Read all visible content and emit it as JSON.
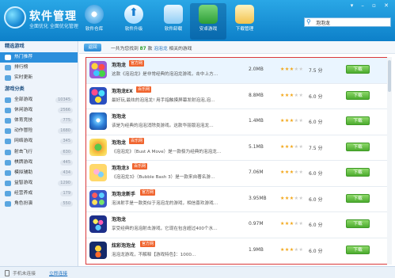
{
  "app": {
    "title": "软件管理",
    "subtitle": "全面优化 全面优化管理"
  },
  "window_controls": "▾ – ▫ ✕",
  "nav": [
    {
      "label": "软件仓库",
      "icon": "store-icon"
    },
    {
      "label": "软件升级",
      "icon": "upgrade-icon"
    },
    {
      "label": "软件卸载",
      "icon": "uninstall-icon"
    },
    {
      "label": "安卓游戏",
      "icon": "android-games-icon"
    },
    {
      "label": "下载管理",
      "icon": "download-manager-icon"
    }
  ],
  "search": {
    "value": "泡泡龙",
    "icon": "search-icon"
  },
  "sidebar": {
    "section1": "精选游戏",
    "featured": [
      {
        "label": "热门推荐",
        "active": true
      },
      {
        "label": "排行榜"
      },
      {
        "label": "实时更新"
      }
    ],
    "section2": "游戏分类",
    "categories": [
      {
        "label": "全部游戏",
        "count": "10345"
      },
      {
        "label": "休闲游戏",
        "count": "2566"
      },
      {
        "label": "体育竞技",
        "count": "775"
      },
      {
        "label": "动作冒险",
        "count": "1680"
      },
      {
        "label": "网络游戏",
        "count": "345"
      },
      {
        "label": "射击飞行",
        "count": "630"
      },
      {
        "label": "棋牌游戏",
        "count": "445"
      },
      {
        "label": "模拟辅助",
        "count": "434"
      },
      {
        "label": "益智游戏",
        "count": "1290"
      },
      {
        "label": "经营养成",
        "count": "179"
      },
      {
        "label": "角色扮演",
        "count": "550"
      }
    ]
  },
  "toolbar": {
    "back_label": "返回",
    "summary_prefix": "一共为您找到",
    "summary_count": "87",
    "summary_mid": "款",
    "summary_keyword": "泡泡龙",
    "summary_suffix": "相关的游戏"
  },
  "apps": [
    {
      "name": "泡泡龙",
      "tag": "官方网",
      "desc": "这款《泡泡龙》是非常经典的泡泡龙游戏，击中上方…",
      "size": "2.0MB",
      "stars": 3,
      "rating": "7.5 分",
      "download": "下载"
    },
    {
      "name": "泡泡龙EX",
      "tag": "百乐网",
      "desc": "最好玩,最炫的泡泡龙! 用手指触摸屏幕发射泡泡,泡…",
      "size": "8.8MB",
      "stars": 3,
      "rating": "6.0 分",
      "download": "下载"
    },
    {
      "name": "泡泡龙",
      "tag": "",
      "desc": "该是为经典的泡泡消除类游戏。这款华丽版泡泡龙…",
      "size": "1.4MB",
      "stars": 3,
      "rating": "6.0 分",
      "download": "下载"
    },
    {
      "name": "泡泡龙",
      "tag": "百乐网",
      "desc": "《泡泡龙》（Bust A Move）是一款极为经典的泡泡龙…",
      "size": "5.1MB",
      "stars": 3,
      "rating": "7.5 分",
      "download": "下载"
    },
    {
      "name": "泡泡龙3",
      "tag": "百乐网",
      "desc": "《泡泡龙3》（Bubble Bash 3）是一款来自著名游…",
      "size": "7.06M",
      "stars": 3,
      "rating": "6.0 分",
      "download": "下载"
    },
    {
      "name": "泡泡龙新手",
      "tag": "官方网",
      "desc": "泡沫射手是一款类似于泡泡龙的游戏，相信喜欢游戏…",
      "size": "3.95MB",
      "stars": 3,
      "rating": "6.0 分",
      "download": "下载"
    },
    {
      "name": "泡泡龙",
      "tag": "",
      "desc": "享受经典的泡泡射击游戏，它现在包含超过400个水…",
      "size": "0.97M",
      "stars": 3,
      "rating": "6.0 分",
      "download": "下载"
    },
    {
      "name": "炫彩泡泡龙",
      "tag": "官方网",
      "desc": "泡泡龙游戏，不解释【游戏特色】：1000…",
      "size": "1.9MB",
      "stars": 3,
      "rating": "6.0 分",
      "download": "下载"
    }
  ],
  "status": {
    "text": "手机未连接",
    "link": "立即连接"
  },
  "colors": {
    "accent": "#2b8fdc",
    "download": "#4cac2e",
    "tag": "#f0652f",
    "highlight_border": "#d9383a"
  }
}
